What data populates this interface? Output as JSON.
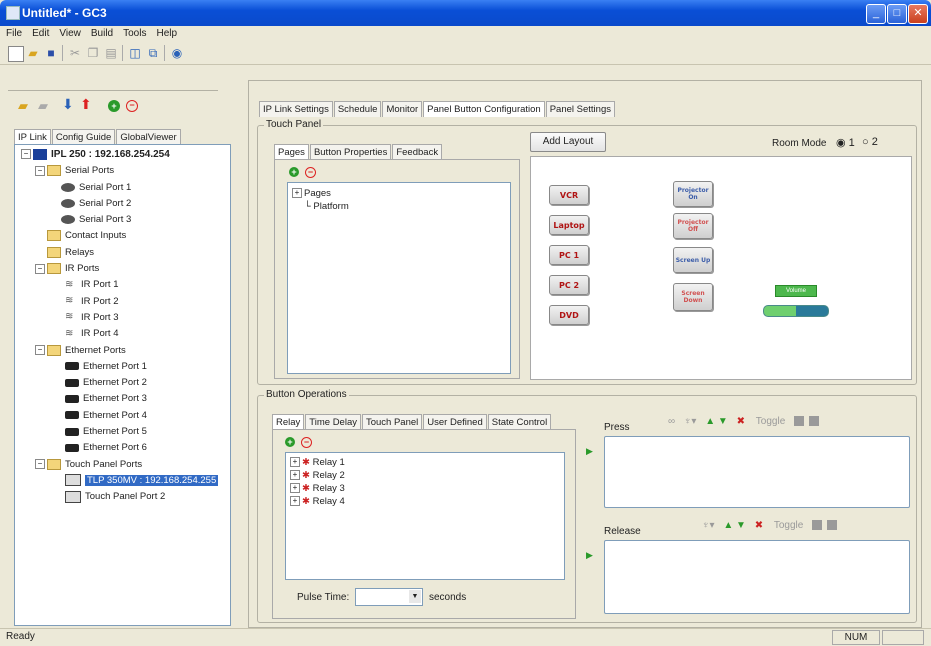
{
  "window": {
    "title": "Untitled* - GC3"
  },
  "menu": [
    "File",
    "Edit",
    "View",
    "Build",
    "Tools",
    "Help"
  ],
  "left_tabs": [
    "IP Link",
    "Config Guide",
    "GlobalViewer"
  ],
  "tree": {
    "root": "IPL 250 : 192.168.254.254",
    "serial_ports": {
      "label": "Serial Ports",
      "items": [
        "Serial Port 1",
        "Serial Port 2",
        "Serial Port 3"
      ]
    },
    "contact_inputs": "Contact Inputs",
    "relays": "Relays",
    "ir_ports": {
      "label": "IR Ports",
      "items": [
        "IR Port 1",
        "IR Port 2",
        "IR Port 3",
        "IR Port 4"
      ]
    },
    "ethernet_ports": {
      "label": "Ethernet Ports",
      "items": [
        "Ethernet Port 1",
        "Ethernet Port 2",
        "Ethernet Port 3",
        "Ethernet Port 4",
        "Ethernet Port 5",
        "Ethernet Port 6"
      ]
    },
    "touch_panel_ports": {
      "label": "Touch Panel Ports",
      "items": [
        "TLP 350MV : 192.168.254.255",
        "Touch Panel Port 2"
      ]
    }
  },
  "main_tabs": [
    "IP Link Settings",
    "Schedule",
    "Monitor",
    "Panel Button Configuration",
    "Panel Settings"
  ],
  "touch_panel": {
    "group_label": "Touch Panel",
    "tabs": [
      "Pages",
      "Button Properties",
      "Feedback"
    ],
    "pages_tree": {
      "root": "Pages",
      "child": "Platform"
    },
    "add_layout": "Add Layout",
    "room_mode_label": "Room Mode",
    "room_mode_options": [
      "1",
      "2"
    ],
    "layout_buttons": {
      "vcr": "VCR",
      "laptop": "Laptop",
      "pc1": "PC 1",
      "pc2": "PC 2",
      "dvd": "DVD",
      "projector_on": "Projector On",
      "projector_off": "Projector Off",
      "screen_up": "Screen Up",
      "screen_down": "Screen Down",
      "volume": "Volume"
    }
  },
  "button_operations": {
    "group_label": "Button Operations",
    "tabs": [
      "Relay",
      "Time Delay",
      "Touch Panel",
      "User Defined",
      "State Control"
    ],
    "relays": [
      "Relay 1",
      "Relay 2",
      "Relay 3",
      "Relay 4"
    ],
    "pulse_time_label": "Pulse Time:",
    "pulse_time_value": "",
    "seconds_label": "seconds",
    "press_label": "Press",
    "release_label": "Release",
    "toggle_label": "Toggle"
  },
  "status": {
    "left": "Ready",
    "right": "NUM"
  }
}
